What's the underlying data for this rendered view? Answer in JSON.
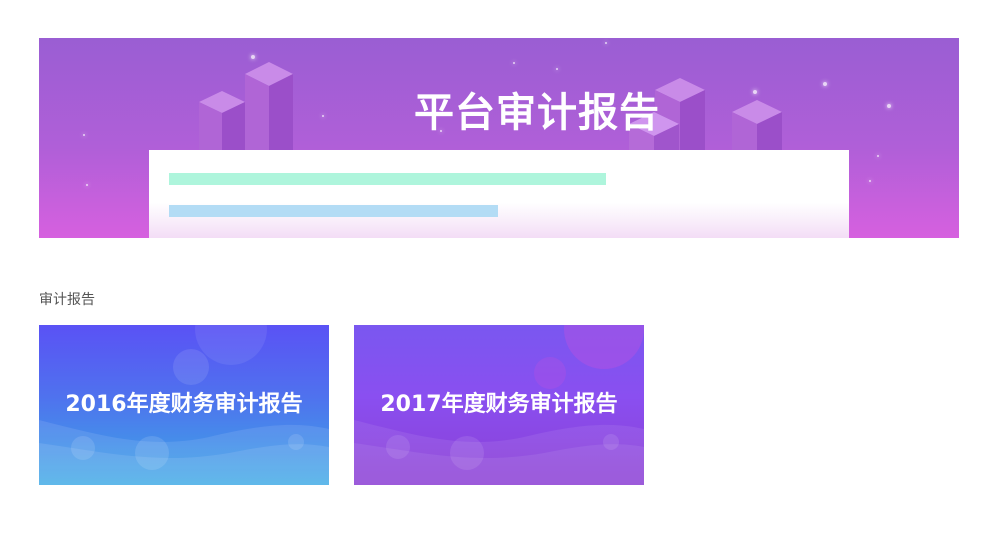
{
  "banner": {
    "title": "平台审计报告"
  },
  "section": {
    "label": "审计报告"
  },
  "reports": [
    {
      "title": "2016年度财务审计报告"
    },
    {
      "title": "2017年度财务审计报告"
    }
  ],
  "colors": {
    "banner_top": "#9a5ed3",
    "banner_bottom": "#d660df",
    "bar_green": "#aef5dc",
    "bar_blue": "#b3dcf5",
    "card_2016_top": "#5a52f5",
    "card_2016_bottom": "#3ca8e6",
    "card_2017_top": "#7a57f0",
    "card_2017_bottom": "#8b3fd4"
  },
  "icons": [
    "isometric-building-icon",
    "star-icon"
  ]
}
